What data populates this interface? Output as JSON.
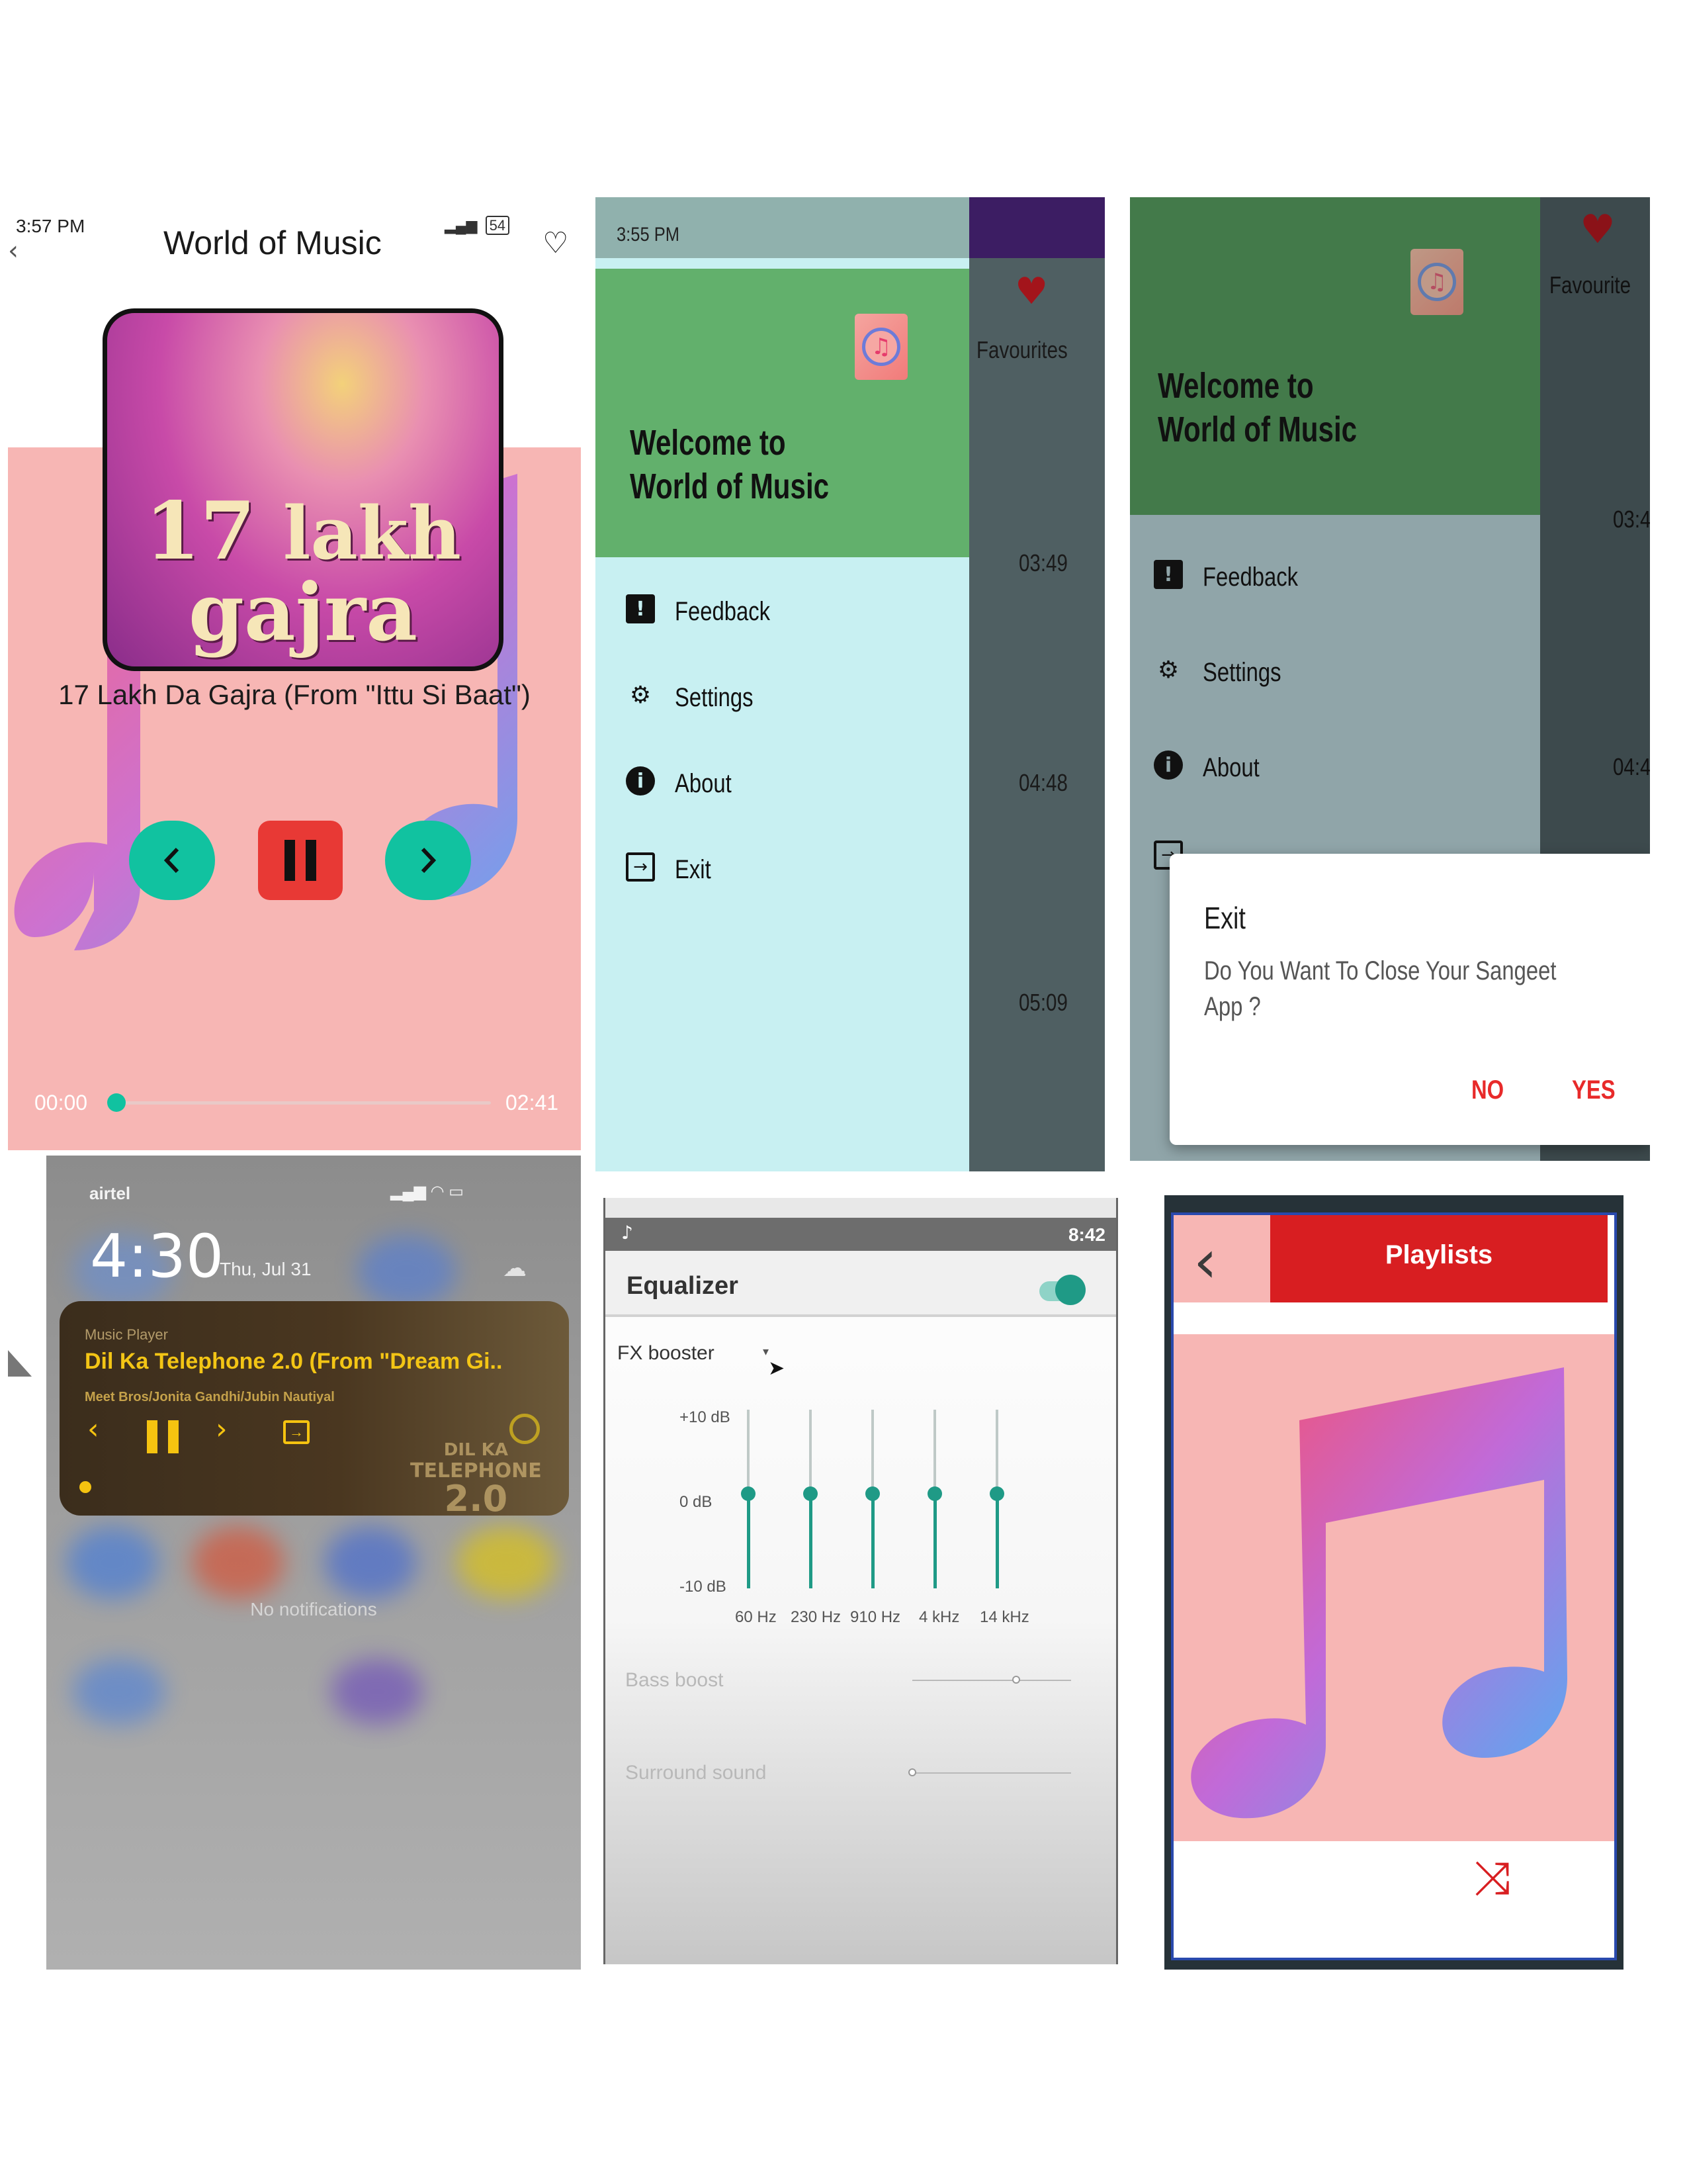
{
  "colors": {
    "teal": "#11c2a0",
    "red": "#e83935",
    "pink": "#f7b6b4",
    "drawer_green": "#62b06c",
    "dialog_red": "#e82a2a",
    "eq_teal": "#1f9a86",
    "playlist_red": "#d81e21"
  },
  "player": {
    "status_time": "3:57 PM",
    "battery": "54",
    "title": "World of Music",
    "album_title_line1": "17",
    "album_title_line2": "lakh",
    "album_title_line3": "gajra",
    "song": "17 Lakh Da Gajra (From \"Ittu Si Baat\")",
    "time_current": "00:00",
    "time_total": "02:41",
    "progress": 0.0,
    "icons": [
      "back-arrow-icon",
      "heart-outline-icon",
      "previous-icon",
      "pause-icon",
      "next-icon"
    ]
  },
  "drawer": {
    "status_time": "3:55 PM",
    "welcome_line1": "Welcome to",
    "welcome_line2": "World of Music",
    "menu": [
      {
        "label": "Feedback",
        "icon": "feedback-icon"
      },
      {
        "label": "Settings",
        "icon": "gear-icon"
      },
      {
        "label": "About",
        "icon": "info-icon"
      },
      {
        "label": "Exit",
        "icon": "exit-icon"
      }
    ],
    "favourites": "Favourites",
    "durations": [
      "03:49",
      "04:48",
      "05:09"
    ]
  },
  "exit_dialog": {
    "favourites": "Favourite",
    "welcome_line1": "Welcome to",
    "welcome_line2": "World of Music",
    "menu": [
      {
        "label": "Feedback",
        "icon": "feedback-icon"
      },
      {
        "label": "Settings",
        "icon": "gear-icon"
      },
      {
        "label": "About",
        "icon": "info-icon"
      }
    ],
    "durations": [
      "03:4",
      "04:4"
    ],
    "dialog_title": "Exit",
    "dialog_message": "Do You Want To Close Your Sangeet App ?",
    "no_label": "NO",
    "yes_label": "YES"
  },
  "lockscreen": {
    "carrier": "airtel",
    "time": "4:30",
    "date": "Thu, Jul 31",
    "player_label": "Music Player",
    "song": "Dil Ka Telephone 2.0 (From \"Dream Gi..",
    "artist": "Meet Bros/Jonita Gandhi/Jubin Nautiyal",
    "art_line1": "DIL KA",
    "art_line2": "TELEPHONE",
    "art_line3": "2.0",
    "no_notifications": "No notifications"
  },
  "equalizer": {
    "status_time": "8:42",
    "title": "Equalizer",
    "enabled": true,
    "preset": "FX booster",
    "db_labels": [
      "+10 dB",
      "0 dB",
      "-10 dB"
    ],
    "bands": [
      {
        "freq": "60 Hz",
        "gain_db": 0
      },
      {
        "freq": "230 Hz",
        "gain_db": 0
      },
      {
        "freq": "910 Hz",
        "gain_db": 0
      },
      {
        "freq": "4 kHz",
        "gain_db": 0
      },
      {
        "freq": "14 kHz",
        "gain_db": 0
      }
    ],
    "bass_boost": "Bass boost",
    "bass_boost_level": 0.65,
    "surround": "Surround sound",
    "surround_level": 0.0
  },
  "playlists": {
    "title": "Playlists",
    "icons": [
      "back-chevron-icon",
      "shuffle-icon"
    ]
  }
}
